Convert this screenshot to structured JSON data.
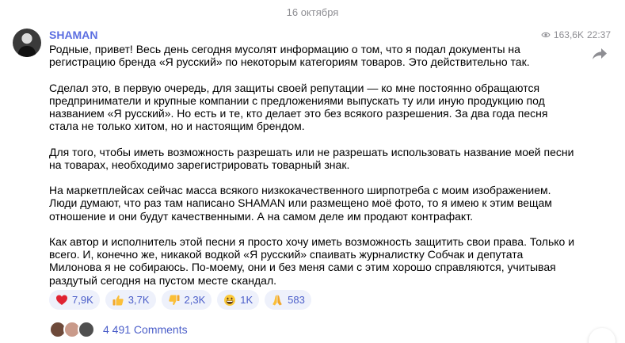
{
  "date_separator": "16 октября",
  "post": {
    "sender": "SHAMAN",
    "views": "163,6K",
    "time": "22:37",
    "paragraphs": [
      "Родные, привет! Весь день сегодня мусолят информацию о том, что я подал документы на\nрегистрацию бренда «Я русский» по некоторым категориям товаров. Это действительно так.",
      "Сделал это, в первую очередь, для защиты своей репутации — ко мне постоянно обращаются\nпредприниматели и крупные компании с предложениями выпускать ту или иную продукцию под\nназванием «Я русский». Но есть и те, кто делает это без всякого разрешения. За два года песня\nстала не только хитом, но и настоящим брендом.",
      "Для того, чтобы иметь возможность разрешать или не разрешать использовать название моей песни\nна товарах, необходимо зарегистрировать товарный знак.",
      "На маркетплейсах сейчас масса всякого низкокачественного ширпотреба с моим изображением.\nЛюди думают, что раз там написано SHAMAN или размещено моё фото, то я имею к этим вещам\nотношение и они будут качественными. А на самом деле им продают контрафакт.",
      "Как автор и исполнитель этой песни я просто хочу иметь возможность защитить свои права. Только и\nвсего. И, конечно же, никакой водкой «Я русский» спаивать журналистку Собчак и депутата\nМилонова я не собираюсь. По-моему, они и без меня сами с этим хорошо справляются, учитывая\nраздутый сегодня на пустом месте скандал."
    ],
    "reactions": [
      {
        "icon": "heart-icon",
        "count": "7,9K"
      },
      {
        "icon": "thumbs-up-icon",
        "count": "3,7K"
      },
      {
        "icon": "thumbs-down-icon",
        "count": "2,3K"
      },
      {
        "icon": "grinning-face-icon",
        "count": "1K"
      },
      {
        "icon": "praying-hands-icon",
        "count": "583"
      }
    ],
    "comments_label": "4 491 Comments"
  },
  "colors": {
    "accent": "#5b6ee1",
    "reaction_bg": "#eef1fb",
    "reaction_text": "#4b5ec9",
    "meta": "#8e8e93"
  }
}
